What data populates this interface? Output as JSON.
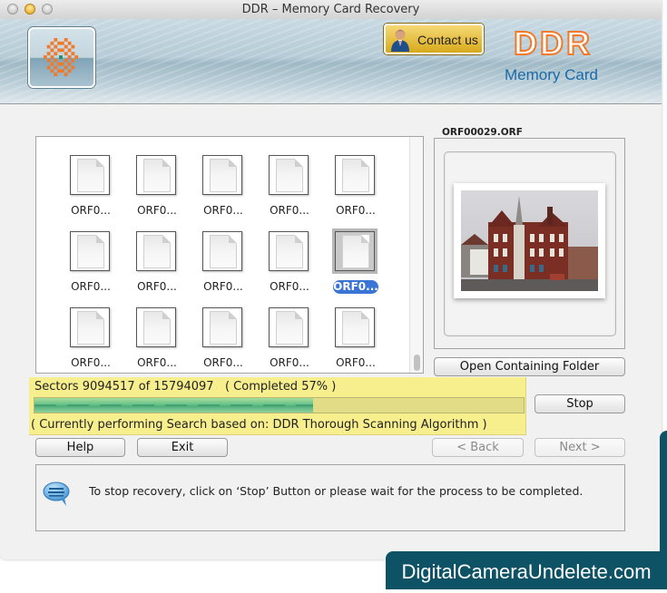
{
  "window": {
    "title": "DDR – Memory Card Recovery"
  },
  "banner": {
    "contact_label": "Contact us",
    "brand_name": "DDR",
    "brand_subtitle": "Memory Card"
  },
  "file_grid": {
    "items": [
      {
        "label": "ORF0...",
        "selected": false
      },
      {
        "label": "ORF0...",
        "selected": false
      },
      {
        "label": "ORF0...",
        "selected": false
      },
      {
        "label": "ORF0...",
        "selected": false
      },
      {
        "label": "ORF0...",
        "selected": false
      },
      {
        "label": "ORF0...",
        "selected": false
      },
      {
        "label": "ORF0...",
        "selected": false
      },
      {
        "label": "ORF0...",
        "selected": false
      },
      {
        "label": "ORF0...",
        "selected": false
      },
      {
        "label": "ORF0...",
        "selected": true
      },
      {
        "label": "ORF0...",
        "selected": false
      },
      {
        "label": "ORF0...",
        "selected": false
      },
      {
        "label": "ORF0...",
        "selected": false
      },
      {
        "label": "ORF0...",
        "selected": false
      },
      {
        "label": "ORF0...",
        "selected": false
      }
    ]
  },
  "preview": {
    "title": "ORF00029.ORF",
    "image_description": "red brick corner building"
  },
  "buttons": {
    "open_folder": "Open Containing Folder",
    "stop": "Stop",
    "help": "Help",
    "exit": "Exit",
    "back": "< Back",
    "next": "Next >"
  },
  "progress": {
    "sectors_text": "Sectors 9094517 of 15794097   ( Completed 57% )",
    "sectors_done": 9094517,
    "sectors_total": 15794097,
    "percent": 57,
    "algorithm_text": "( Currently performing Search based on: DDR Thorough Scanning Algorithm )"
  },
  "info": {
    "message": "To stop recovery, click on ‘Stop’ Button or please wait for the process to be completed."
  },
  "watermark": {
    "text": "DigitalCameraUndelete.com"
  },
  "colors": {
    "accent_orange": "#f07a2a",
    "brand_blue": "#1a6aa8",
    "progress_panel": "#f7ee8e",
    "selection_blue": "#3a74d4",
    "watermark_bg": "#0e5266"
  }
}
